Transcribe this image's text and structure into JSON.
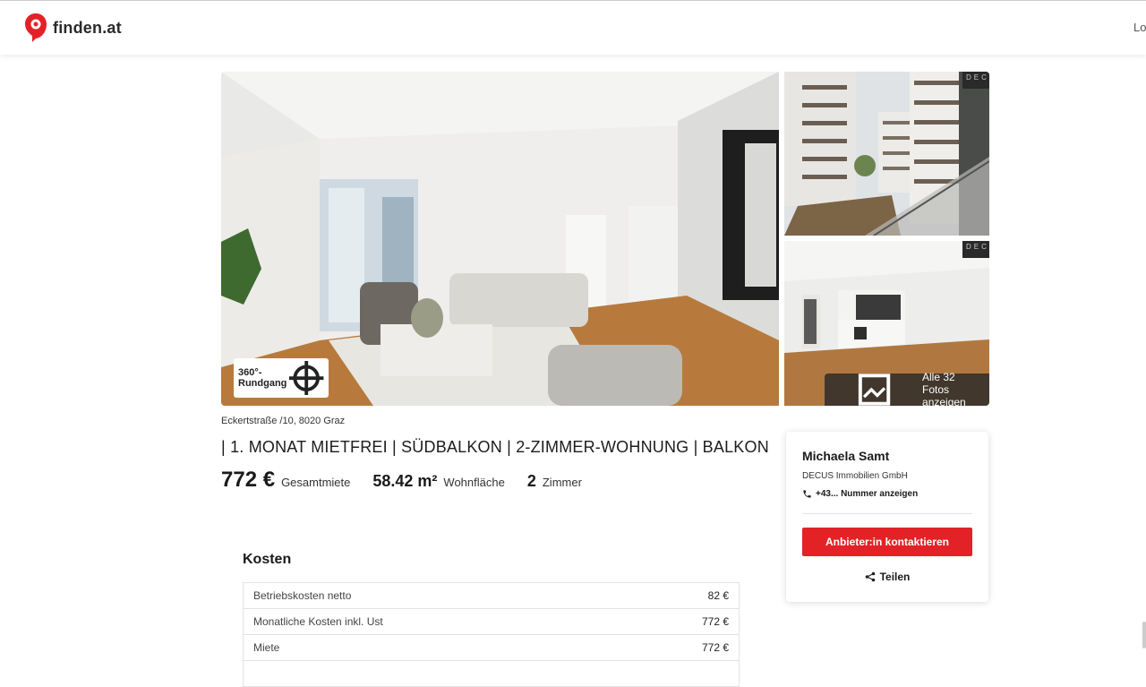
{
  "header": {
    "logo_text": "finden.at",
    "login_label": "Login"
  },
  "gallery": {
    "badge_360": "360°-Rundgang",
    "side_logo": "DEC",
    "all_photos_label": "Alle 32 Fotos anzeigen"
  },
  "listing": {
    "address": "Eckertstraße /10, 8020 Graz",
    "title": "| 1. MONAT MIETFREI | SÜDBALKON | 2-ZIMMER-WOHNUNG | BALKON",
    "price_value": "772 €",
    "price_label": "Gesamtmiete",
    "area_value": "58.42 m²",
    "area_label": "Wohnfläche",
    "rooms_value": "2",
    "rooms_label": "Zimmer"
  },
  "kosten": {
    "title": "Kosten",
    "rows": [
      {
        "label": "Betriebskosten netto",
        "value": "82 €"
      },
      {
        "label": "Monatliche Kosten inkl. Ust",
        "value": "772 €"
      },
      {
        "label": "Miete",
        "value": "772 €"
      }
    ]
  },
  "contact": {
    "name": "Michaela Samt",
    "company": "DECUS Immobilien GmbH",
    "phone": "+43... Nummer anzeigen",
    "button_label": "Anbieter:in kontaktieren",
    "share_label": "Teilen"
  },
  "colors": {
    "brand_red": "#e32227"
  }
}
